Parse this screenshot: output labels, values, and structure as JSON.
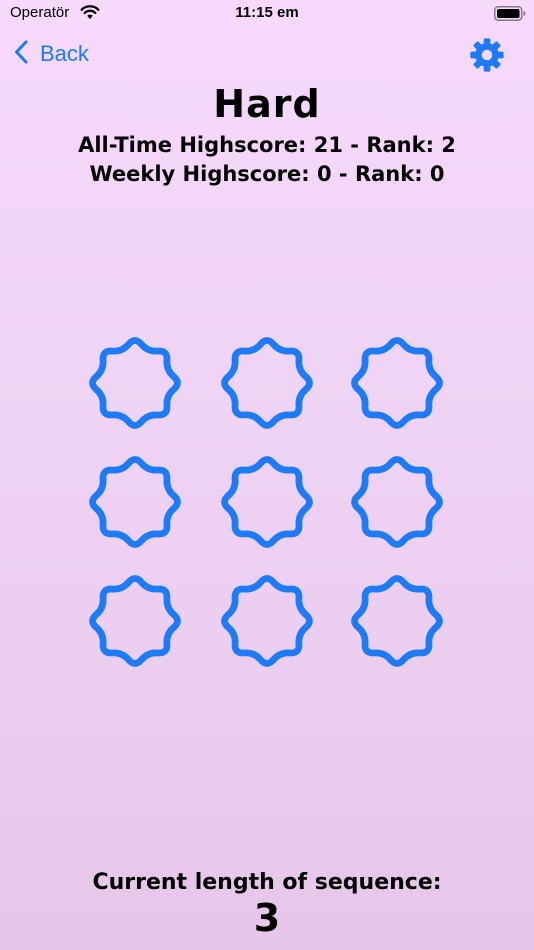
{
  "status_bar": {
    "carrier": "Operatör",
    "time": "11:15 em"
  },
  "nav": {
    "back_label": "Back",
    "settings_icon": "gear-icon"
  },
  "game": {
    "difficulty": "Hard",
    "all_time": "All-Time Highscore: 21 - Rank: 2",
    "weekly": "Weekly Highscore: 0 - Rank: 0",
    "tile_icon": "eight-point-star-outline",
    "tile_color": "#1e7bf6",
    "tiles": [
      {
        "row": 1,
        "col": 1
      },
      {
        "row": 1,
        "col": 2
      },
      {
        "row": 1,
        "col": 3
      },
      {
        "row": 2,
        "col": 1
      },
      {
        "row": 2,
        "col": 2
      },
      {
        "row": 2,
        "col": 3
      },
      {
        "row": 3,
        "col": 1
      },
      {
        "row": 3,
        "col": 2
      },
      {
        "row": 3,
        "col": 3
      }
    ]
  },
  "footer": {
    "label": "Current length of sequence:",
    "value": "3"
  },
  "colors": {
    "accent": "#1e7bf6",
    "background_top": "#f6d9fb",
    "background_bottom": "#e6c6e9"
  }
}
